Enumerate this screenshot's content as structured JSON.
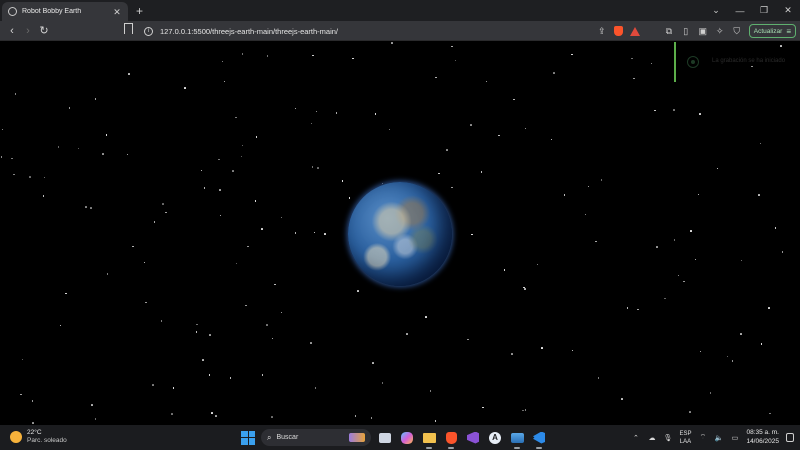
{
  "browser": {
    "tab": {
      "title": "Robot Bobby Earth",
      "favicon": "globe-icon"
    },
    "window_controls": [
      "minimize-icon",
      "restore-icon",
      "close-icon"
    ],
    "toolbar": {
      "url": "127.0.0.1:5500/threejs-earth-main/threejs-earth-main/",
      "update_label": "Actualizar"
    },
    "accent": "#5fb06f"
  },
  "overlay": {
    "recording_text": "La grabación se ha iniciado"
  },
  "taskbar": {
    "weather": {
      "temp": "22°C",
      "desc": "Parc. soleado"
    },
    "search_placeholder": "Buscar",
    "tray": {
      "lang_top": "ESP",
      "lang_bottom": "LAA",
      "time": "08:35 a. m.",
      "date": "14/06/2025"
    }
  }
}
